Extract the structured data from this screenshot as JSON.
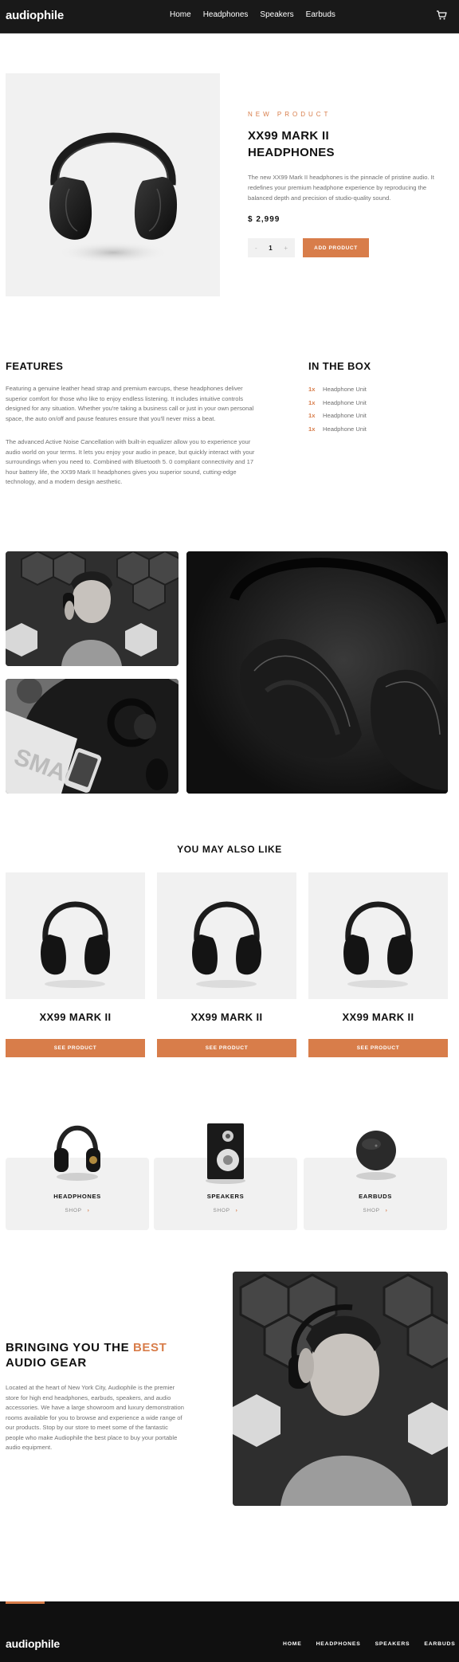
{
  "header": {
    "logo": "audiophile",
    "nav": [
      "Home",
      "Headphones",
      "Speakers",
      "Earbuds"
    ],
    "cart_icon": "cart-icon"
  },
  "product": {
    "eyebrow": "NEW PRODUCT",
    "title": "XX99 MARK II HEADPHONES",
    "description": "The new XX99 Mark II headphones is the pinnacle of pristine audio. It redefines your premium headphone experience by reproducing the balanced depth and precision of studio-quality sound.",
    "price": "$ 2,999",
    "quantity": "1",
    "minus": "-",
    "plus": "+",
    "add_label": "ADD PRODUCT"
  },
  "features": {
    "heading": "FEATURES",
    "p1": "Featuring a genuine leather head strap and premium earcups, these headphones deliver superior comfort for those who like to enjoy endless listening. It includes intuitive controls designed for any situation. Whether you're taking a business call or just in your own personal space, the auto on/off and pause features ensure that you'll never miss a beat.",
    "p2": "The advanced Active Noise Cancellation with built-in equalizer allow you to experience your audio world on your terms. It lets you enjoy your audio in peace, but quickly interact with your surroundings when you need to. Combined with Bluetooth 5. 0 compliant connectivity and 17 hour battery life, the XX99 Mark II headphones gives you superior sound, cutting-edge technology, and a modern design aesthetic."
  },
  "in_the_box": {
    "heading": "IN THE BOX",
    "items": [
      {
        "qty": "1x",
        "name": "Headphone Unit"
      },
      {
        "qty": "1x",
        "name": "Headphone Unit"
      },
      {
        "qty": "1x",
        "name": "Headphone Unit"
      },
      {
        "qty": "1x",
        "name": "Headphone Unit"
      }
    ]
  },
  "also_like": {
    "heading": "YOU MAY ALSO LIKE",
    "cards": [
      {
        "name": "XX99 MARK II",
        "button": "SEE PRODUCT"
      },
      {
        "name": "XX99 MARK II",
        "button": "SEE PRODUCT"
      },
      {
        "name": "XX99 MARK II",
        "button": "SEE PRODUCT"
      }
    ]
  },
  "categories": [
    {
      "name": "HEADPHONES",
      "shop": "SHOP",
      "icon": "chevron-right-icon"
    },
    {
      "name": "SPEAKERS",
      "shop": "SHOP",
      "icon": "chevron-right-icon"
    },
    {
      "name": "EARBUDS",
      "shop": "SHOP",
      "icon": "chevron-right-icon"
    }
  ],
  "about": {
    "heading_pre": "BRINGING YOU THE ",
    "heading_accent": "BEST",
    "heading_post": "AUDIO GEAR",
    "body": "Located at the heart of New York City, Audiophile is the premier store for high end headphones, earbuds, speakers, and audio accessories. We have a large showroom and luxury demonstration rooms available for you to browse and experience a wide range of our products. Stop by our store to meet some of the fantastic people who make Audiophile the best place to buy your portable audio equipment."
  },
  "footer": {
    "logo": "audiophile",
    "nav": [
      "HOME",
      "HEADPHONES",
      "SPEAKERS",
      "EARBUDS"
    ]
  },
  "colors": {
    "accent": "#d87d4a",
    "dark": "#191919",
    "light_gray": "#f1f1f1"
  }
}
